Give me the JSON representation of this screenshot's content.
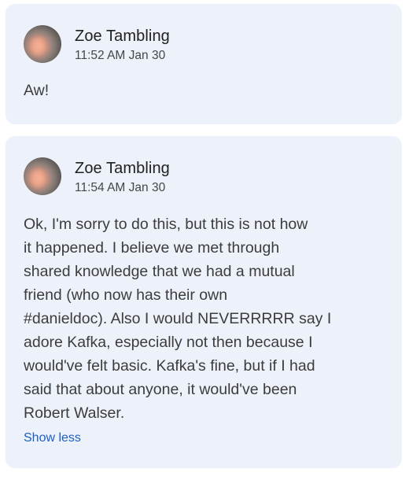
{
  "comments": [
    {
      "author": "Zoe Tambling",
      "timestamp": "11:52 AM Jan 30",
      "text": "Aw!"
    },
    {
      "author": "Zoe Tambling",
      "timestamp": "11:54 AM Jan 30",
      "text": "Ok, I'm sorry to do this, but this is not how\nit happened. I believe we met through\nshared knowledge that we had a mutual\nfriend (who now has their own\n#danieldoc). Also I would NEVERRRRR say I\nadore Kafka, especially not then because I\nwould've felt basic. Kafka's fine, but if I had\nsaid that about anyone, it would've been\nRobert Walser.",
      "toggle_label": "Show less"
    }
  ],
  "colors": {
    "card_background": "#edf1fa",
    "link": "#1a5fc8"
  }
}
